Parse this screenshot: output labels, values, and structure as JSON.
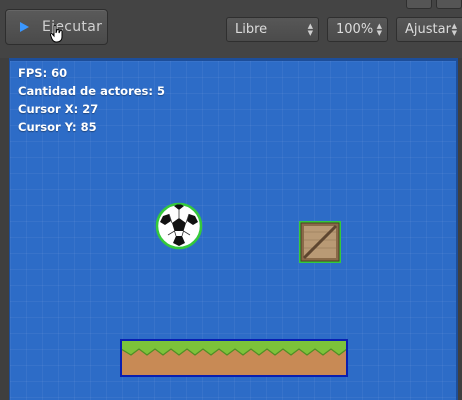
{
  "toolbar": {
    "run_label": "Ejecutar",
    "mode_select": "Libre",
    "zoom_select": "100%",
    "fit_select": "Ajustar"
  },
  "stats": {
    "fps": "FPS: 60",
    "actors": "Cantidad de actores: 5",
    "cursor_x": "Cursor X: 27",
    "cursor_y": "Cursor Y: 85"
  },
  "colors": {
    "accent": "#3a97ff",
    "canvas_bg": "#2d6cc7",
    "selection_outline": "#35c93b",
    "platform_outline": "#0a1fb0"
  },
  "icons": [
    "play-icon",
    "hand-cursor-icon",
    "select-arrows-icon"
  ]
}
